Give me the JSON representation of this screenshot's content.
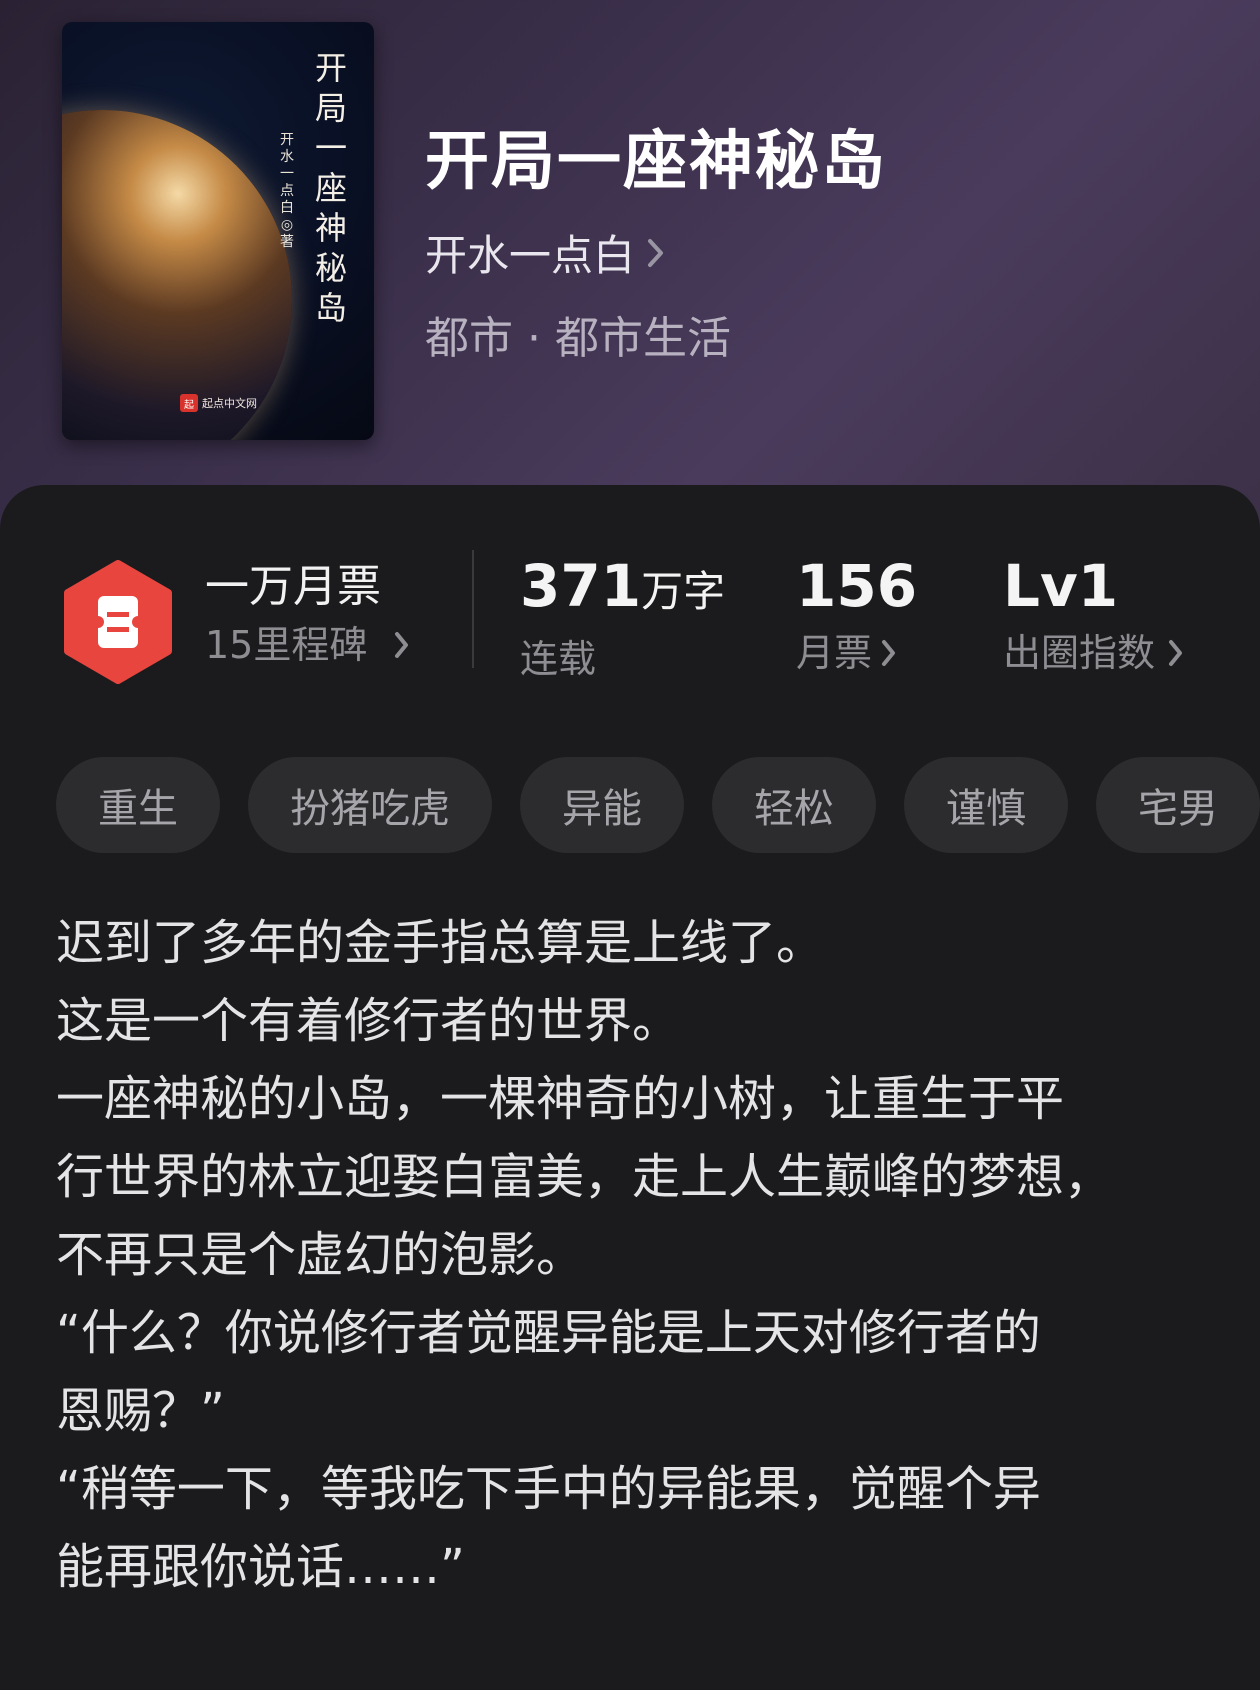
{
  "book": {
    "title": "开局一座神秘岛",
    "author": "开水一点白",
    "genre": "都市 · 都市生活",
    "cover": {
      "title_chars": [
        "开",
        "局",
        "一",
        "座",
        "神",
        "秘",
        "岛"
      ],
      "author_chars": [
        "开",
        "水",
        "一",
        "点",
        "白",
        "◎",
        "著"
      ],
      "publisher": "起点中文网",
      "publisher_logo": "起"
    }
  },
  "stats": {
    "badge_icon": "ticket-icon",
    "badge_color": "#e8453f",
    "badge_title": "一万月票",
    "badge_subtitle": "15里程碑",
    "word_count_number": "371",
    "word_count_unit": "万字",
    "word_count_label": "连载",
    "monthly_votes": "156",
    "monthly_votes_label": "月票",
    "level": "Lv1",
    "level_label": "出圈指数"
  },
  "tags": [
    "重生",
    "扮猪吃虎",
    "异能",
    "轻松",
    "谨慎",
    "宅男"
  ],
  "synopsis": [
    "迟到了多年的金手指总算是上线了。",
    "这是一个有着修行者的世界。",
    "一座神秘的小岛，一棵神奇的小树，让重生于平",
    "行世界的林立迎娶白富美，走上人生巅峰的梦想，",
    "不再只是个虚幻的泡影。",
    "“什么？你说修行者觉醒异能是上天对修行者的",
    "恩赐？”",
    "“稍等一下，等我吃下手中的异能果，觉醒个异",
    "能再跟你说话……”"
  ]
}
